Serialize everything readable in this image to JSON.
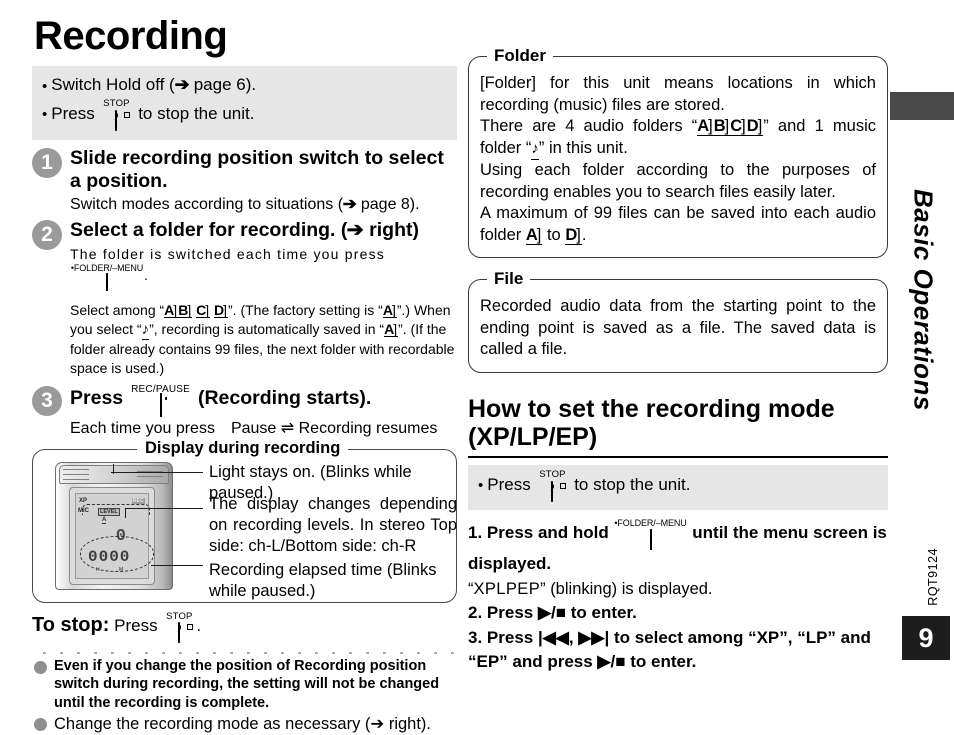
{
  "page": {
    "title": "Recording",
    "chapter_label": "Basic Operations",
    "doc_code": "RQT9124",
    "page_number": "9"
  },
  "icons": {
    "stop_cap": "STOP",
    "folder_menu_cap": "•FOLDER/–MENU",
    "rec_pause_cap": "REC/PAUSE"
  },
  "left": {
    "notes": {
      "line1_a": "Switch Hold off (",
      "line1_arrow": "➔",
      "line1_b": " page 6).",
      "line2_a": "Press",
      "line2_b": "to stop the unit."
    },
    "steps": [
      {
        "num": "1",
        "head": "Slide recording position switch to select a position.",
        "sub_a": "Switch modes according to situations (",
        "sub_arrow": "➔",
        "sub_b": " page 8)."
      },
      {
        "num": "2",
        "head_a": "Select a folder for recording. (",
        "head_arrow": "➔",
        "head_b": " right)",
        "line1_a": "The folder is switched each time you press",
        "line1_b": ".",
        "line2_a": "Select among “",
        "folders": [
          "A",
          "B",
          "C",
          "D"
        ],
        "line2_b": "”. (The factory setting is “",
        "line2_default": "A",
        "line2_c": "”.) When you select “",
        "line2_d": "”, recording is automatically saved in “",
        "line2_e": "”. (If the folder already contains 99 files, the next folder with recordable space is used.)"
      },
      {
        "num": "3",
        "head_a": "Press",
        "head_b": "(Recording starts).",
        "sub": "Each time you press Pause ⇌ Recording resumes"
      }
    ],
    "display_panel": {
      "title": "Display during recording",
      "callouts": [
        "Light stays on. (Blinks while paused.)",
        "The display changes depending on recording levels. In stereo Top side: ch-L/Bottom side: ch-R",
        "Recording elapsed time (Blinks while paused.)"
      ],
      "lcd": {
        "mode": "XP",
        "rec_badge": "REC",
        "mic": "MIC",
        "level": "LEVEL",
        "folder": "A",
        "big_digit": "0",
        "digits": "0000",
        "hm": "H M"
      }
    },
    "to_stop": {
      "label": "To stop:",
      "text_a": "Press",
      "text_b": "."
    },
    "footnotes": [
      "Even if you change the position of Recording position switch during recording, the setting will not be changed until the recording is complete.",
      "Change the recording mode as necessary (➔ right)."
    ]
  },
  "right": {
    "folder_box": {
      "title": "Folder",
      "p1": "[Folder] for this unit means locations in which recording (music) files are stored.",
      "p2_a": "There are 4 audio folders “",
      "p2_folders": [
        "A",
        "B",
        "C",
        "D"
      ],
      "p2_b": "” and 1 music folder “",
      "p2_c": "” in this unit.",
      "p3": "Using each folder according to the purposes of recording enables you to search files easily later.",
      "p4_a": "A maximum of 99 files can be saved into each audio folder ",
      "p4_from": "A",
      "p4_mid": " to ",
      "p4_to": "D",
      "p4_b": "."
    },
    "file_box": {
      "title": "File",
      "p1": "Recorded audio data from the starting point to the ending point is saved as a file. The saved data is called a file."
    },
    "section": {
      "heading_line1": "How to set the recording mode",
      "heading_line2": "(XP/LP/EP)",
      "note_a": "Press",
      "note_b": "to stop the unit.",
      "steps": [
        {
          "index": "1.",
          "text_a": "Press and hold",
          "text_b": "until the menu screen is displayed.",
          "sub_a": "“",
          "sub_modes": "XPLPEP",
          "sub_b": "” (blinking) is displayed."
        },
        {
          "index": "2.",
          "text_a": "Press ▶/■ to enter."
        },
        {
          "index": "3.",
          "text_a": "Press |◀◀, ▶▶| to select among “XP”, “LP” and “EP” and press ▶/■ to enter."
        }
      ]
    }
  }
}
